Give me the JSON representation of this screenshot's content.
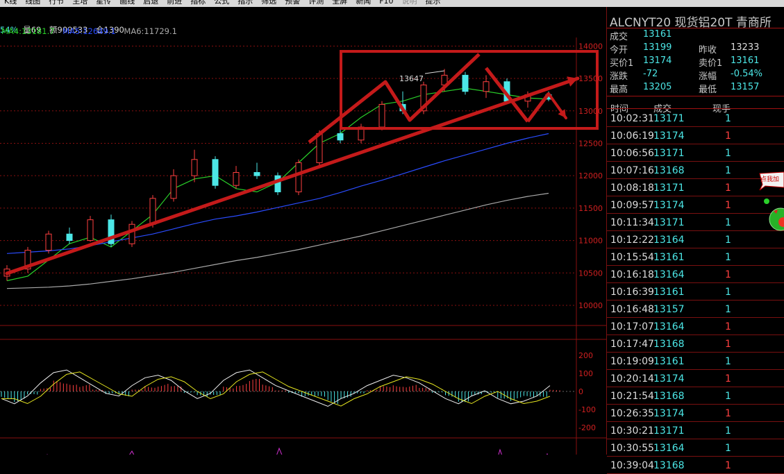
{
  "menu": [
    "K线",
    "线图",
    "行节",
    "主培",
    "星传",
    "画线",
    "启退",
    "前进",
    "指标",
    "公式",
    "指示",
    "筛选",
    "预警",
    "评测",
    "全屏",
    "新闻",
    "F10",
    "说明",
    "提示"
  ],
  "menu_dim_index": 17,
  "info": {
    "pct_fragment": "54%",
    "volume": "量69",
    "amount": "额909533",
    "position": "仓1390",
    "ma4": "MA4:13181.7",
    "ma5": "MA5:12649.1",
    "ma6": "MA6:11729.1"
  },
  "colors": {
    "ma4": "#2ad02a",
    "ma5": "#2a4cff",
    "ma6": "#aaaaaa",
    "up": "#ff4040",
    "down": "#4ce7e7",
    "annot": "#c41a1a",
    "grid": "#8a1010"
  },
  "chart_labels": {
    "peak": "13647"
  },
  "price_ticks": [
    "14000",
    "13500",
    "13000",
    "12500",
    "12000",
    "11500",
    "11000",
    "10500",
    "10000"
  ],
  "macd_ticks": [
    "200",
    "100",
    "0",
    "-100",
    "-200"
  ],
  "sidebar": {
    "title": "ALCNYT20 现货铝20T 青商所",
    "quote": [
      {
        "l1": "成交",
        "v1": "13161",
        "c1": "cyan",
        "l2": "",
        "v2": "",
        "c2": ""
      },
      {
        "l1": "今开",
        "v1": "13199",
        "c1": "cyan",
        "l2": "昨收",
        "v2": "13233",
        "c2": "white"
      },
      {
        "l1": "买价1",
        "v1": "13174",
        "c1": "cyan",
        "l2": "卖价1",
        "v2": "13161",
        "c2": "cyan"
      },
      {
        "l1": "涨跌",
        "v1": "-72",
        "c1": "cyan",
        "l2": "涨幅",
        "v2": "-0.54%",
        "c2": "cyan"
      },
      {
        "l1": "最高",
        "v1": "13205",
        "c1": "cyan",
        "l2": "最低",
        "v2": "13157",
        "c2": "cyan"
      }
    ],
    "trades_header": {
      "time": "时间",
      "price": "成交",
      "qty": "现手"
    },
    "trades": [
      {
        "time": "10:02:31",
        "price": "13171",
        "qty": "1",
        "dir": "dn"
      },
      {
        "time": "10:06:19",
        "price": "13174",
        "qty": "1",
        "dir": "up"
      },
      {
        "time": "10:06:56",
        "price": "13171",
        "qty": "1",
        "dir": "dn"
      },
      {
        "time": "10:07:16",
        "price": "13168",
        "qty": "1",
        "dir": "dn"
      },
      {
        "time": "10:08:18",
        "price": "13171",
        "qty": "1",
        "dir": "up"
      },
      {
        "time": "10:09:57",
        "price": "13174",
        "qty": "1",
        "dir": "up"
      },
      {
        "time": "10:11:34",
        "price": "13171",
        "qty": "1",
        "dir": "dn"
      },
      {
        "time": "10:12:22",
        "price": "13164",
        "qty": "1",
        "dir": "dn"
      },
      {
        "time": "10:15:54",
        "price": "13161",
        "qty": "1",
        "dir": "dn"
      },
      {
        "time": "10:16:18",
        "price": "13164",
        "qty": "1",
        "dir": "up"
      },
      {
        "time": "10:16:39",
        "price": "13161",
        "qty": "1",
        "dir": "dn"
      },
      {
        "time": "10:16:48",
        "price": "13157",
        "qty": "1",
        "dir": "dn"
      },
      {
        "time": "10:17:07",
        "price": "13164",
        "qty": "1",
        "dir": "up"
      },
      {
        "time": "10:17:47",
        "price": "13168",
        "qty": "1",
        "dir": "up"
      },
      {
        "time": "10:19:09",
        "price": "13161",
        "qty": "1",
        "dir": "dn"
      },
      {
        "time": "10:20:14",
        "price": "13174",
        "qty": "1",
        "dir": "up"
      },
      {
        "time": "10:21:54",
        "price": "13168",
        "qty": "1",
        "dir": "dn"
      },
      {
        "time": "10:26:35",
        "price": "13174",
        "qty": "1",
        "dir": "up"
      },
      {
        "time": "10:30:21",
        "price": "13171",
        "qty": "1",
        "dir": "dn"
      },
      {
        "time": "10:30:55",
        "price": "13164",
        "qty": "1",
        "dir": "dn"
      },
      {
        "time": "10:39:04",
        "price": "13168",
        "qty": "1",
        "dir": "up"
      }
    ]
  },
  "popup": {
    "label": "点我加"
  },
  "chart_data": {
    "type": "line",
    "ylim": [
      9700,
      14100
    ],
    "ma_series": [
      {
        "name": "MA4",
        "values": [
          10380,
          10450,
          10700,
          10950,
          11050,
          10900,
          11150,
          11400,
          11800,
          11950,
          12000,
          11800,
          11750,
          11900,
          12200,
          12500,
          12650,
          12900,
          13100,
          13150,
          13250,
          13300,
          13350,
          13300,
          13250,
          13200,
          13180
        ]
      },
      {
        "name": "MA5",
        "values": [
          10800,
          10820,
          10840,
          10870,
          10920,
          10980,
          11040,
          11100,
          11180,
          11260,
          11330,
          11380,
          11440,
          11510,
          11580,
          11650,
          11740,
          11840,
          11930,
          12030,
          12130,
          12230,
          12320,
          12410,
          12500,
          12580,
          12649
        ]
      },
      {
        "name": "MA6",
        "values": [
          10260,
          10270,
          10280,
          10300,
          10330,
          10370,
          10410,
          10460,
          10510,
          10570,
          10630,
          10690,
          10740,
          10800,
          10860,
          10930,
          11000,
          11070,
          11150,
          11230,
          11310,
          11390,
          11470,
          11550,
          11620,
          11680,
          11729
        ]
      }
    ],
    "candles": [
      {
        "o": 10450,
        "h": 10620,
        "l": 10380,
        "c": 10560
      },
      {
        "o": 10560,
        "h": 10900,
        "l": 10500,
        "c": 10850
      },
      {
        "o": 10850,
        "h": 11150,
        "l": 10800,
        "c": 11100
      },
      {
        "o": 11100,
        "h": 11200,
        "l": 10950,
        "c": 11000
      },
      {
        "o": 11000,
        "h": 11380,
        "l": 10980,
        "c": 11320
      },
      {
        "o": 11320,
        "h": 11400,
        "l": 10900,
        "c": 10950
      },
      {
        "o": 10950,
        "h": 11300,
        "l": 10900,
        "c": 11250
      },
      {
        "o": 11250,
        "h": 11700,
        "l": 11200,
        "c": 11650
      },
      {
        "o": 11650,
        "h": 12100,
        "l": 11600,
        "c": 12000
      },
      {
        "o": 12000,
        "h": 12400,
        "l": 11900,
        "c": 12250
      },
      {
        "o": 12250,
        "h": 12300,
        "l": 11800,
        "c": 11850
      },
      {
        "o": 11850,
        "h": 12150,
        "l": 11800,
        "c": 12050
      },
      {
        "o": 12050,
        "h": 12200,
        "l": 11950,
        "c": 12000
      },
      {
        "o": 12000,
        "h": 12050,
        "l": 11700,
        "c": 11750
      },
      {
        "o": 11750,
        "h": 12250,
        "l": 11700,
        "c": 12200
      },
      {
        "o": 12200,
        "h": 12700,
        "l": 12150,
        "c": 12650
      },
      {
        "o": 12650,
        "h": 12900,
        "l": 12500,
        "c": 12550
      },
      {
        "o": 12550,
        "h": 12800,
        "l": 12500,
        "c": 12750
      },
      {
        "o": 12750,
        "h": 13150,
        "l": 12700,
        "c": 13100
      },
      {
        "o": 13100,
        "h": 13300,
        "l": 12950,
        "c": 13000
      },
      {
        "o": 13000,
        "h": 13450,
        "l": 12950,
        "c": 13400
      },
      {
        "o": 13400,
        "h": 13647,
        "l": 13300,
        "c": 13550
      },
      {
        "o": 13550,
        "h": 13600,
        "l": 13250,
        "c": 13300
      },
      {
        "o": 13300,
        "h": 13550,
        "l": 13200,
        "c": 13450
      },
      {
        "o": 13450,
        "h": 13500,
        "l": 13100,
        "c": 13150
      },
      {
        "o": 13150,
        "h": 13300,
        "l": 13050,
        "c": 13250
      },
      {
        "o": 13250,
        "h": 13300,
        "l": 13150,
        "c": 13181
      }
    ],
    "macd_hist": [
      -40,
      -60,
      -30,
      20,
      60,
      70,
      40,
      10,
      -20,
      -30,
      10,
      40,
      50,
      30,
      -10,
      -40,
      -20,
      30,
      60,
      70,
      40,
      10,
      -10,
      -30,
      -50,
      -70,
      -40,
      -20,
      10,
      30,
      50,
      40,
      20,
      -10,
      -40,
      -60,
      -30,
      -10,
      -40,
      -60,
      -50,
      -30,
      10
    ]
  }
}
